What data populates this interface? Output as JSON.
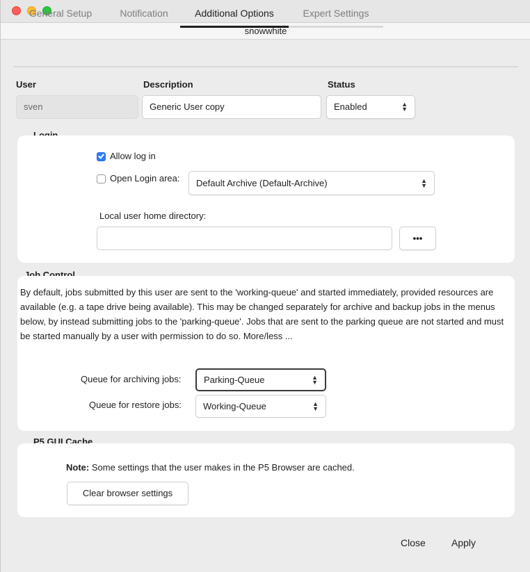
{
  "window": {
    "title": "snowwhite"
  },
  "tabs": [
    {
      "label": "General Setup"
    },
    {
      "label": "Notification"
    },
    {
      "label": "Additional Options"
    },
    {
      "label": "Expert Settings"
    }
  ],
  "user_row": {
    "user_label": "User",
    "description_label": "Description",
    "status_label": "Status",
    "user_value": "sven",
    "description_value": "Generic User copy",
    "status_value": "Enabled"
  },
  "login": {
    "heading": "Login",
    "allow_login_label": "Allow log in",
    "allow_login_checked": true,
    "open_login_area_label": "Open Login area:",
    "open_login_area_checked": false,
    "login_area_value": "Default Archive (Default-Archive)",
    "home_dir_label": "Local user home directory:",
    "home_dir_value": "",
    "browse_label": "•••"
  },
  "job_control": {
    "heading": "Job Control",
    "description": "By default, jobs submitted by this user are sent to the 'working-queue' and started immediately, provided resources are available (e.g. a tape drive being available). This may be changed separately for archive and backup jobs in the menus below, by instead submitting jobs to the 'parking-queue'. Jobs that are sent to the parking queue are not started and must be started manually by a user with permission to do so.",
    "more_less": "More/less ...",
    "archiving_label": "Queue for archiving jobs:",
    "archiving_value": "Parking-Queue",
    "restore_label": "Queue for restore jobs:",
    "restore_value": "Working-Queue"
  },
  "gui_cache": {
    "heading": "P5 GUI Cache",
    "note_bold": "Note:",
    "note_text": "Some settings that the user makes in the P5 Browser are cached.",
    "clear_label": "Clear browser settings"
  },
  "footer": {
    "close_label": "Close",
    "apply_label": "Apply"
  }
}
